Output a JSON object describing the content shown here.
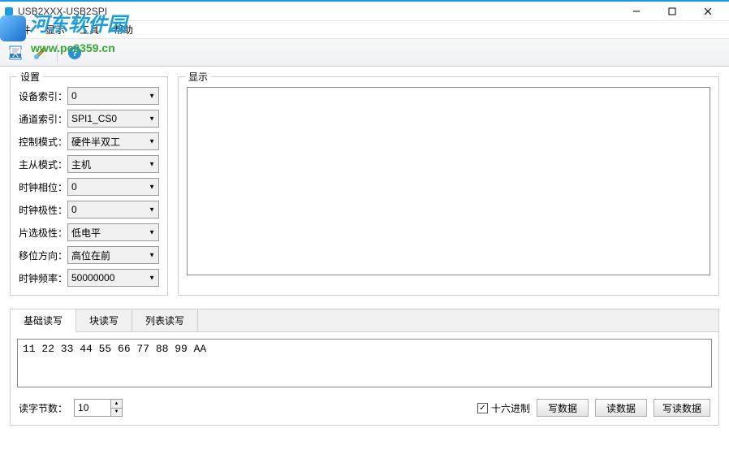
{
  "window": {
    "title": "USB2XXX-USB2SPI"
  },
  "watermark": {
    "line1": "河东软件园",
    "line2": "www.pc0359.cn"
  },
  "menubar": {
    "file": "文件",
    "display": "显示",
    "tools": "工具",
    "help": "帮助"
  },
  "settings": {
    "title": "设置",
    "rows": {
      "device_index": {
        "label": "设备索引：",
        "value": "0"
      },
      "channel_index": {
        "label": "通道索引：",
        "value": "SPI1_CS0"
      },
      "control_mode": {
        "label": "控制模式：",
        "value": "硬件半双工"
      },
      "master_slave": {
        "label": "主从模式：",
        "value": "主机"
      },
      "clock_phase": {
        "label": "时钟相位：",
        "value": "0"
      },
      "clock_polarity": {
        "label": "时钟极性：",
        "value": "0"
      },
      "cs_polarity": {
        "label": "片选极性：",
        "value": "低电平"
      },
      "shift_dir": {
        "label": "移位方向：",
        "value": "高位在前"
      },
      "clock_freq": {
        "label": "时钟频率：",
        "value": "50000000"
      }
    }
  },
  "display_panel": {
    "title": "显示"
  },
  "tabs": {
    "basic": "基础读写",
    "block": "块读写",
    "list": "列表读写"
  },
  "hex_text": "11 22 33 44 55 66 77 88 99 AA",
  "action_row": {
    "read_bytes_label": "读字节数：",
    "read_bytes_value": "10",
    "hex_checkbox": "十六进制",
    "hex_checked": true,
    "write_btn": "写数据",
    "read_btn": "读数据",
    "write_read_btn": "写读数据"
  }
}
